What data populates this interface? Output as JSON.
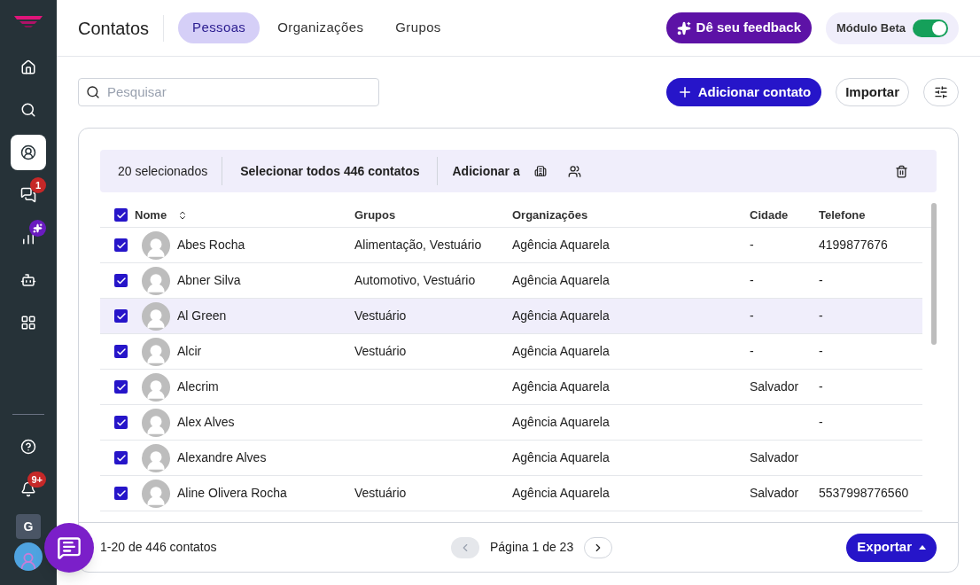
{
  "sidebar": {
    "items": [
      {
        "selected": false,
        "sparkle_badge": false
      },
      {
        "selected": false,
        "sparkle_badge": false
      },
      {
        "selected": true,
        "sparkle_badge": false
      },
      {
        "selected": false,
        "badge": "1",
        "sparkle_badge": false
      },
      {
        "selected": false,
        "sparkle_badge": true
      },
      {
        "selected": false,
        "sparkle_badge": false
      },
      {
        "selected": false,
        "sparkle_badge": false
      }
    ],
    "bottom": [
      {
        "sparkle_badge": false
      },
      {
        "badge": "9+",
        "sparkle_badge": false
      }
    ],
    "workspace_initial": "G"
  },
  "header": {
    "title": "Contatos",
    "tabs": [
      {
        "label": "Pessoas",
        "selected": true
      },
      {
        "label": "Organizações",
        "selected": false
      },
      {
        "label": "Grupos",
        "selected": false
      }
    ],
    "feedback_button": "Dê seu feedback",
    "beta": {
      "label": "Módulo Beta",
      "on": true
    }
  },
  "toolbar": {
    "search": {
      "placeholder": "Pesquisar"
    },
    "add_button": "Adicionar contato",
    "import_button": "Importar"
  },
  "selection_bar": {
    "count": "20 selecionados",
    "select_all": "Selecionar todos 446 contatos",
    "add_to": "Adicionar a"
  },
  "table": {
    "all_checked": true,
    "columns": [
      "Nome",
      "Grupos",
      "Organizações",
      "Cidade",
      "Telefone"
    ],
    "rows": [
      {
        "checked": true,
        "highlighted": false,
        "cells": [
          "Abes Rocha",
          "Alimentação, Vestuário",
          "Agência Aquarela",
          "-",
          "4199877676"
        ]
      },
      {
        "checked": true,
        "highlighted": false,
        "cells": [
          "Abner Silva",
          "Automotivo, Vestuário",
          "Agência Aquarela",
          "-",
          "-"
        ]
      },
      {
        "checked": true,
        "highlighted": true,
        "cells": [
          "Al Green",
          "Vestuário",
          "Agência Aquarela",
          "-",
          "-"
        ]
      },
      {
        "checked": true,
        "highlighted": false,
        "cells": [
          "Alcir",
          "Vestuário",
          "Agência Aquarela",
          "-",
          "-"
        ]
      },
      {
        "checked": true,
        "highlighted": false,
        "cells": [
          "Alecrim",
          "",
          "Agência Aquarela",
          "Salvador",
          "-"
        ]
      },
      {
        "checked": true,
        "highlighted": false,
        "cells": [
          "Alex Alves",
          "",
          "Agência Aquarela",
          "",
          "-"
        ]
      },
      {
        "checked": true,
        "highlighted": false,
        "cells": [
          "Alexandre Alves",
          "",
          "Agência Aquarela",
          "Salvador",
          ""
        ]
      },
      {
        "checked": true,
        "highlighted": false,
        "cells": [
          "Aline Olivera Rocha",
          "Vestuário",
          "Agência Aquarela",
          "Salvador",
          "5537998776560"
        ]
      }
    ]
  },
  "footer": {
    "range": "1-20 de 446 contatos",
    "page": "Página 1 de 23",
    "export_button": "Exportar"
  }
}
